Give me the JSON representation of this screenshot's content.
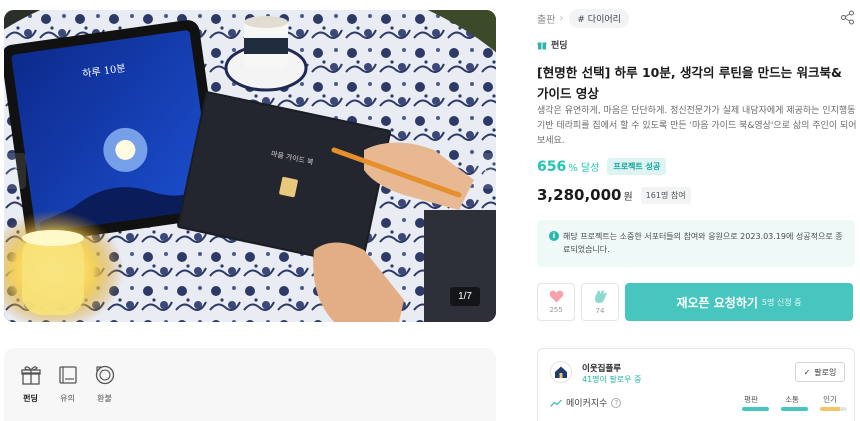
{
  "gallery": {
    "image_alt": "campaign photo",
    "book_title": "마음 가이드 북",
    "tablet_text": "하루 10분",
    "counter": "1/7",
    "prev_icon": "chevron-left-icon",
    "next_icon": "chevron-right-icon"
  },
  "tabs": [
    {
      "label": "펀딩",
      "icon": "gift-icon",
      "active": true
    },
    {
      "label": "유의",
      "icon": "book-icon",
      "active": false
    },
    {
      "label": "환불",
      "icon": "refund-icon",
      "active": false
    }
  ],
  "breadcrumb": {
    "category": "출판",
    "tag": "# 다이어리"
  },
  "funding_badge": "펀딩",
  "title": "[현명한 선택] 하루 10분, 생각의 루틴을 만드는 워크북&가이드 영상",
  "description": "생각은 유연하게, 마음은 단단하게. 정신전문가가 실제 내담자에게 제공하는 인지행동 기반 테라피를 집에서 할 수 있도록 만든 '마음 가이드 북&영상'으로 삶의 주인이 되어보세요.",
  "achievement": {
    "rate": "656",
    "suffix": "% 달성",
    "badge": "프로젝트 성공"
  },
  "amount": {
    "value": "3,280,000",
    "unit": "원",
    "supporters": "161명 참여"
  },
  "notice": "해당 프로젝트는 소중한 서포터들의 참여와 응원으로 2023.03.19에 성공적으로 종료되었습니다.",
  "actions": {
    "like_count": "255",
    "cheer_count": "74",
    "reopen_label": "재오픈 요청하기",
    "reopen_count": "5명 신청 중"
  },
  "maker": {
    "name": "이웃집플루",
    "followers": "41명이 팔로우 중",
    "follow_label": "팔로잉",
    "index_label": "메이커지수",
    "metrics": [
      {
        "label": "평판",
        "color": "#46c6bf"
      },
      {
        "label": "소통",
        "color": "#46c6bf"
      },
      {
        "label": "인기",
        "color": "#f2c46b"
      }
    ]
  },
  "colors": {
    "accent": "#25c3b6",
    "button": "#46c6bf",
    "notice_bg": "#eef9f8"
  }
}
